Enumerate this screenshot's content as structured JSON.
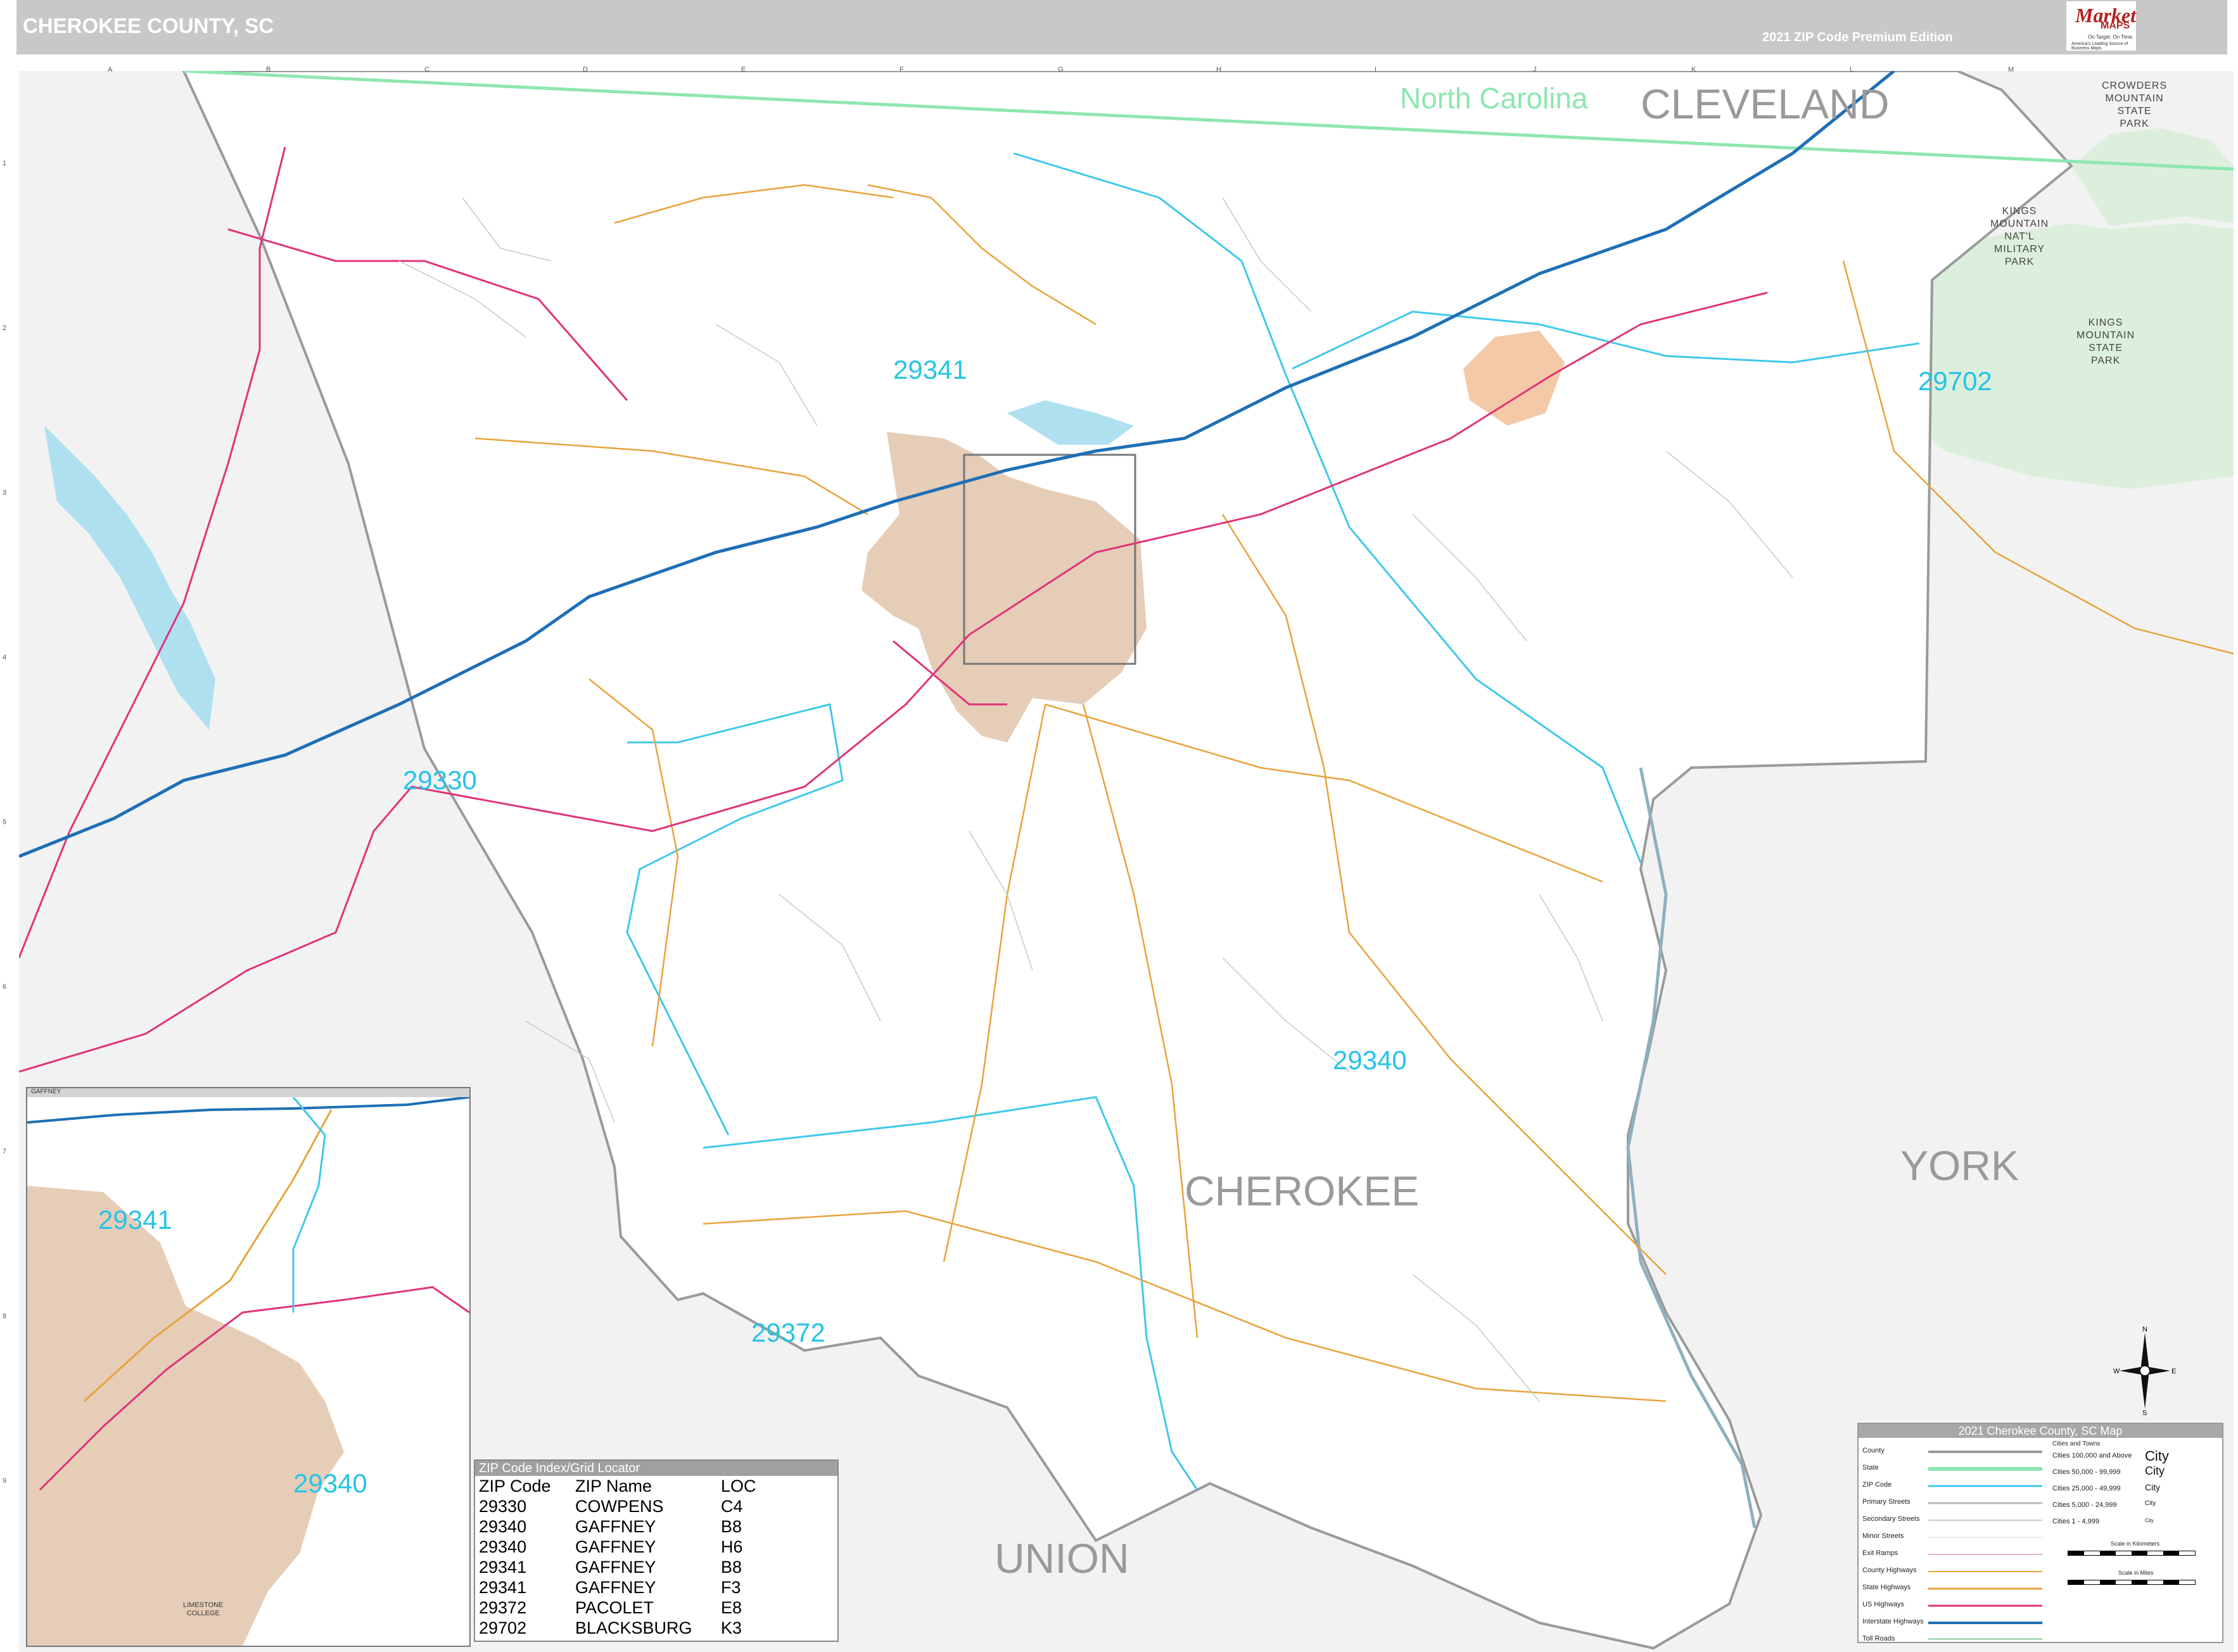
{
  "header": {
    "title": "CHEROKEE COUNTY, SC",
    "edition": "2021 ZIP Code Premium Edition",
    "logo": {
      "market": "Market",
      "maps": "MAPS",
      "tagline1": "On Target. On Time.",
      "tagline2": "America's Leading Source of Business Maps"
    }
  },
  "grid": {
    "columns": [
      "A",
      "B",
      "C",
      "D",
      "E",
      "F",
      "G",
      "H",
      "I",
      "J",
      "K",
      "L",
      "M"
    ],
    "rows": [
      "1",
      "2",
      "3",
      "4",
      "5",
      "6",
      "7",
      "8",
      "9"
    ]
  },
  "labels": {
    "state": "North Carolina",
    "counties": [
      "CLEVELAND",
      "CHEROKEE",
      "YORK",
      "UNION"
    ],
    "zips": [
      "29341",
      "29702",
      "29330",
      "29340",
      "29372"
    ],
    "parks": {
      "crowders": [
        "CROWDERS",
        "MOUNTAIN",
        "STATE",
        "PARK"
      ],
      "military": [
        "KINGS",
        "MOUNTAIN",
        "NAT'L",
        "MILITARY",
        "PARK"
      ],
      "kings_state": [
        "KINGS",
        "MOUNTAIN",
        "STATE",
        "PARK"
      ]
    }
  },
  "inset": {
    "title": "GAFFNEY",
    "zips": [
      "29341",
      "29340"
    ],
    "college": [
      "LIMESTONE",
      "COLLEGE"
    ]
  },
  "zip_index": {
    "title": "ZIP Code Index/Grid Locator",
    "headers": [
      "ZIP Code",
      "ZIP Name",
      "LOC"
    ],
    "rows": [
      [
        "29330",
        "COWPENS",
        "C4"
      ],
      [
        "29340",
        "GAFFNEY",
        "B8"
      ],
      [
        "29340",
        "GAFFNEY",
        "H6"
      ],
      [
        "29341",
        "GAFFNEY",
        "B8"
      ],
      [
        "29341",
        "GAFFNEY",
        "F3"
      ],
      [
        "29372",
        "PACOLET",
        "E8"
      ],
      [
        "29702",
        "BLACKSBURG",
        "K3"
      ]
    ]
  },
  "legend": {
    "title": "2021 Cherokee County, SC Map",
    "items": [
      "County",
      "State",
      "ZIP Code",
      "Primary Streets",
      "Secondary Streets",
      "Minor Streets",
      "Exit Ramps",
      "County Highways",
      "State Highways",
      "US Highways",
      "Interstate Highways",
      "Toll Roads"
    ],
    "cities_header": "Cities and Towns",
    "cities": [
      {
        "label": "Cities 100,000 and Above",
        "sample": "City"
      },
      {
        "label": "Cities 50,000 - 99,999",
        "sample": "City"
      },
      {
        "label": "Cities 25,000 - 49,999",
        "sample": "City"
      },
      {
        "label": "Cities 5,000 - 24,999",
        "sample": "City"
      },
      {
        "label": "Cities 1 - 4,999",
        "sample": "City"
      }
    ],
    "scale_km": "Scale in Kilometers",
    "scale_mi": "Scale in Miles"
  },
  "compass": {
    "n": "N",
    "s": "S",
    "e": "E",
    "w": "W"
  },
  "colors": {
    "zip": "#27c3e6",
    "county_label": "#9a9a9a",
    "state_border": "#8ee6b0",
    "interstate": "#1e6fb5",
    "us_highway": "#e0337a",
    "state_highway": "#e8a33c",
    "county_outside": "#f2f2f2",
    "park": "#dcefdc",
    "city": "#e5cdb8"
  }
}
